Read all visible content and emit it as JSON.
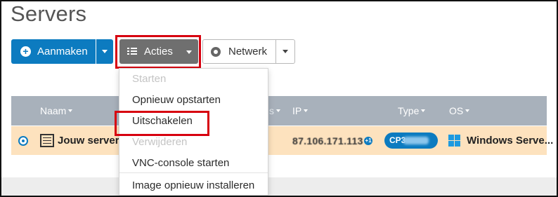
{
  "page": {
    "title": "Servers"
  },
  "toolbar": {
    "create_label": "Aanmaken",
    "actions_label": "Acties",
    "network_label": "Netwerk"
  },
  "actions_menu": {
    "items": [
      {
        "label": "Starten",
        "enabled": false
      },
      {
        "label": "Opnieuw opstarten",
        "enabled": true
      },
      {
        "label": "Uitschakelen",
        "enabled": true,
        "highlighted": true
      },
      {
        "label": "Verwijderen",
        "enabled": false
      },
      {
        "label": "VNC-console starten",
        "enabled": true
      },
      {
        "label": "Image opnieuw installeren",
        "enabled": true
      }
    ]
  },
  "table": {
    "columns": [
      {
        "label": "Naam",
        "sortable": true
      },
      {
        "label": "s",
        "sortable": true
      },
      {
        "label": "IP",
        "sortable": true
      },
      {
        "label": "Type",
        "sortable": true
      },
      {
        "label": "OS",
        "sortable": true
      }
    ],
    "rows": [
      {
        "selected": true,
        "name": "Jouw server",
        "ip": "87.106.171.113",
        "ip_extra_badge": "+1",
        "type": "CP3",
        "os": "Windows Serve..."
      }
    ]
  },
  "colors": {
    "primary": "#0c7bc0",
    "actions_button": "#6f6f6f",
    "highlight": "#d7000f",
    "table_header": "#a8b1bb",
    "selected_row": "#fde2be"
  },
  "icons": {
    "create": "plus-circle-icon",
    "actions": "list-icon",
    "network": "network-icon",
    "server": "server-icon",
    "os": "windows-icon"
  }
}
